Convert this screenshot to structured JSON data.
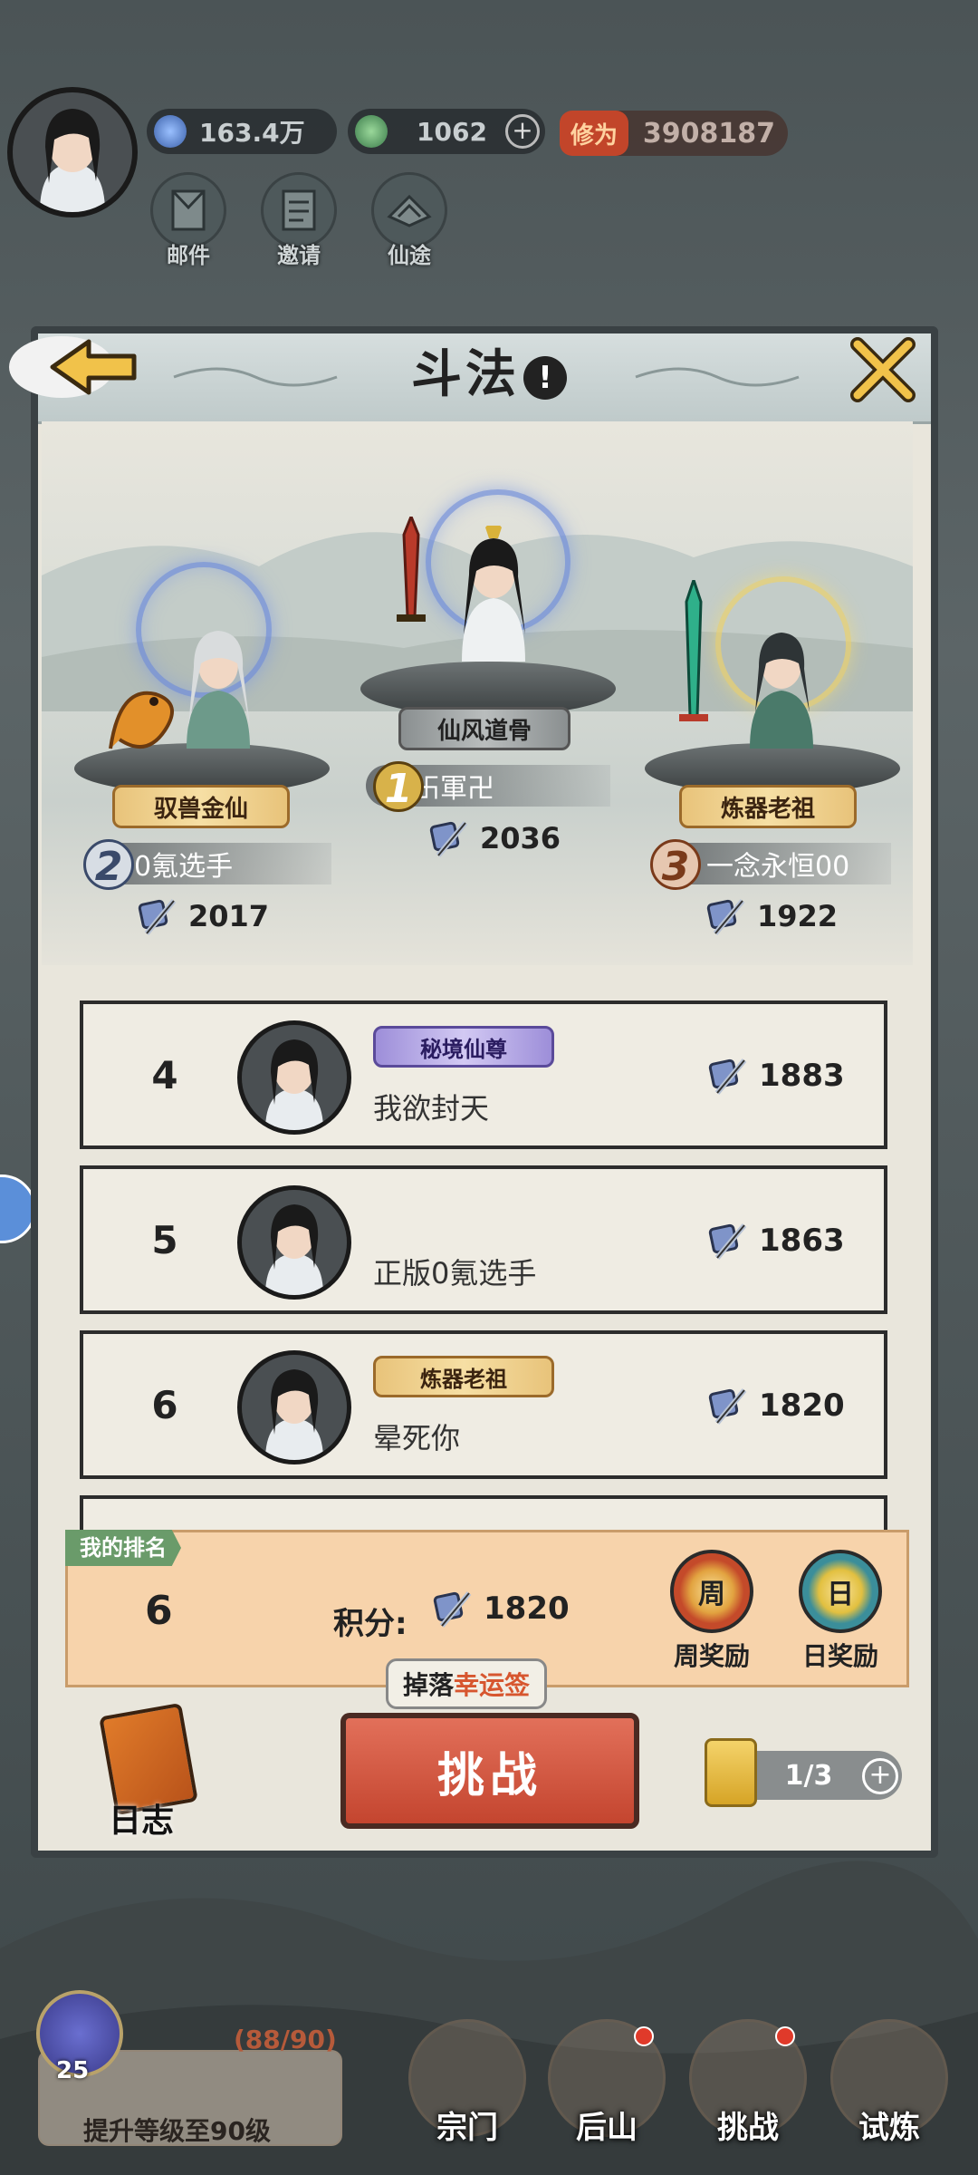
{
  "resources": {
    "spirit_stones": "163.4万",
    "jade": "1062",
    "cultivation_label": "修为",
    "cultivation_value": "3908187"
  },
  "top_buttons": [
    {
      "label": "邮件",
      "icon": "mail-icon"
    },
    {
      "label": "邀请",
      "icon": "invite-icon"
    },
    {
      "label": "仙途",
      "icon": "path-icon"
    }
  ],
  "panel": {
    "title": "斗法",
    "info_glyph": "!"
  },
  "podium": {
    "first": {
      "rank": "1",
      "title": "仙风道骨",
      "name": "卐軍卍",
      "score": "2036"
    },
    "second": {
      "rank": "2",
      "title": "驭兽金仙",
      "name": "0氪选手",
      "score": "2017"
    },
    "third": {
      "rank": "3",
      "title": "炼器老祖",
      "name": "一念永恒00",
      "score": "1922"
    }
  },
  "rankings": [
    {
      "rank": "4",
      "tag": "秘境仙尊",
      "name": "我欲封天",
      "score": "1883"
    },
    {
      "rank": "5",
      "tag": "",
      "name": "正版0氪选手",
      "score": "1863"
    },
    {
      "rank": "6",
      "tag": "炼器老祖",
      "name": "晕死你",
      "score": "1820"
    }
  ],
  "my_rank": {
    "label": "我的排名",
    "rank": "6",
    "score_label": "积分:",
    "score": "1820",
    "weekly_chest": "周",
    "weekly_label": "周奖励",
    "daily_chest": "日",
    "daily_label": "日奖励"
  },
  "actions": {
    "log_label": "日志",
    "drop_tip_prefix": "掉落",
    "drop_tip_highlight": "幸运签",
    "challenge_label": "挑战",
    "tickets": "1/3"
  },
  "quest": {
    "level": "25",
    "progress": "(88/90)",
    "text": "提升等级至90级"
  },
  "bottom_nav": [
    {
      "label": "宗门"
    },
    {
      "label": "后山"
    },
    {
      "label": "挑战"
    },
    {
      "label": "试炼"
    }
  ],
  "colors": {
    "accent_red": "#c4452f",
    "gold": "#e8c37a",
    "panel_bg": "#e9e6dc"
  }
}
